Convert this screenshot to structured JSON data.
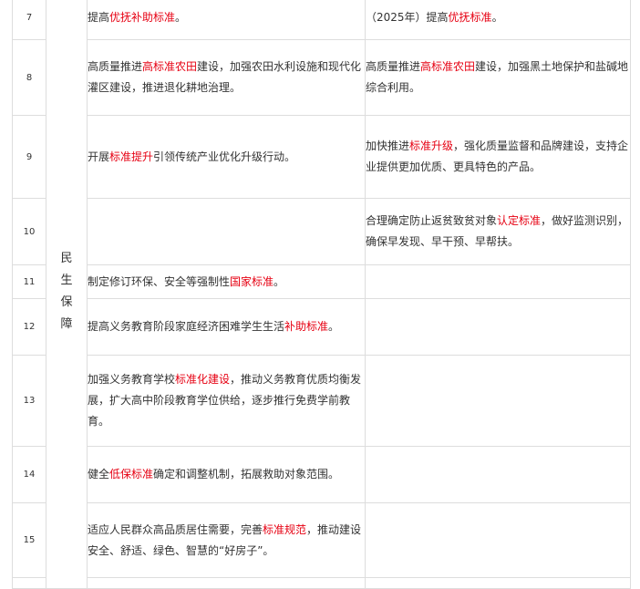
{
  "category": "民生保障",
  "rows": [
    {
      "num": "7",
      "col1": [
        {
          "t": "提高"
        },
        {
          "t": "优抚补助标准",
          "hl": true
        },
        {
          "t": "。"
        }
      ],
      "col2": [
        {
          "t": "（2025年）提高"
        },
        {
          "t": "优抚标准",
          "hl": true
        },
        {
          "t": "。"
        }
      ]
    },
    {
      "num": "8",
      "col1": [
        {
          "t": "高质量推进"
        },
        {
          "t": "高标准农田",
          "hl": true
        },
        {
          "t": "建设，加强农田水利设施和现代化灌区建设，推进退化耕地治理。"
        }
      ],
      "col2": [
        {
          "t": "高质量推进"
        },
        {
          "t": "高标准农田",
          "hl": true
        },
        {
          "t": "建设，加强黑土地保护和盐碱地综合利用。"
        }
      ]
    },
    {
      "num": "9",
      "col1": [
        {
          "t": "开展"
        },
        {
          "t": "标准提升",
          "hl": true
        },
        {
          "t": "引领传统产业优化升级行动。"
        }
      ],
      "col2": [
        {
          "t": "加快推进"
        },
        {
          "t": "标准升级",
          "hl": true
        },
        {
          "t": "，强化质量监督和品牌建设，支持企业提供更加优质、更具特色的产品。"
        }
      ]
    },
    {
      "num": "10",
      "col1": [],
      "col2": [
        {
          "t": "合理确定防止返贫致贫对象"
        },
        {
          "t": "认定标准",
          "hl": true
        },
        {
          "t": "，做好监测识别，确保早发现、早干预、早帮扶。"
        }
      ]
    },
    {
      "num": "11",
      "col1": [
        {
          "t": "制定修订环保、安全等强制性"
        },
        {
          "t": "国家标准",
          "hl": true
        },
        {
          "t": "。"
        }
      ],
      "col2": []
    },
    {
      "num": "12",
      "col1": [
        {
          "t": "提高义务教育阶段家庭经济困难学生生活"
        },
        {
          "t": "补助标准",
          "hl": true
        },
        {
          "t": "。"
        }
      ],
      "col2": []
    },
    {
      "num": "13",
      "col1": [
        {
          "t": "加强义务教育学校"
        },
        {
          "t": "标准化建设",
          "hl": true
        },
        {
          "t": "，推动义务教育优质均衡发展，扩大高中阶段教育学位供给，逐步推行免费学前教育。"
        }
      ],
      "col2": []
    },
    {
      "num": "14",
      "col1": [
        {
          "t": "健全"
        },
        {
          "t": "低保标准",
          "hl": true
        },
        {
          "t": "确定和调整机制，拓展救助对象范围。"
        }
      ],
      "col2": []
    },
    {
      "num": "15",
      "col1": [
        {
          "t": "适应人民群众高品质居住需要，完善"
        },
        {
          "t": "标准规范",
          "hl": true
        },
        {
          "t": "，推动建设安全、舒适、绿色、智慧的“好房子”。"
        }
      ],
      "col2": []
    }
  ]
}
